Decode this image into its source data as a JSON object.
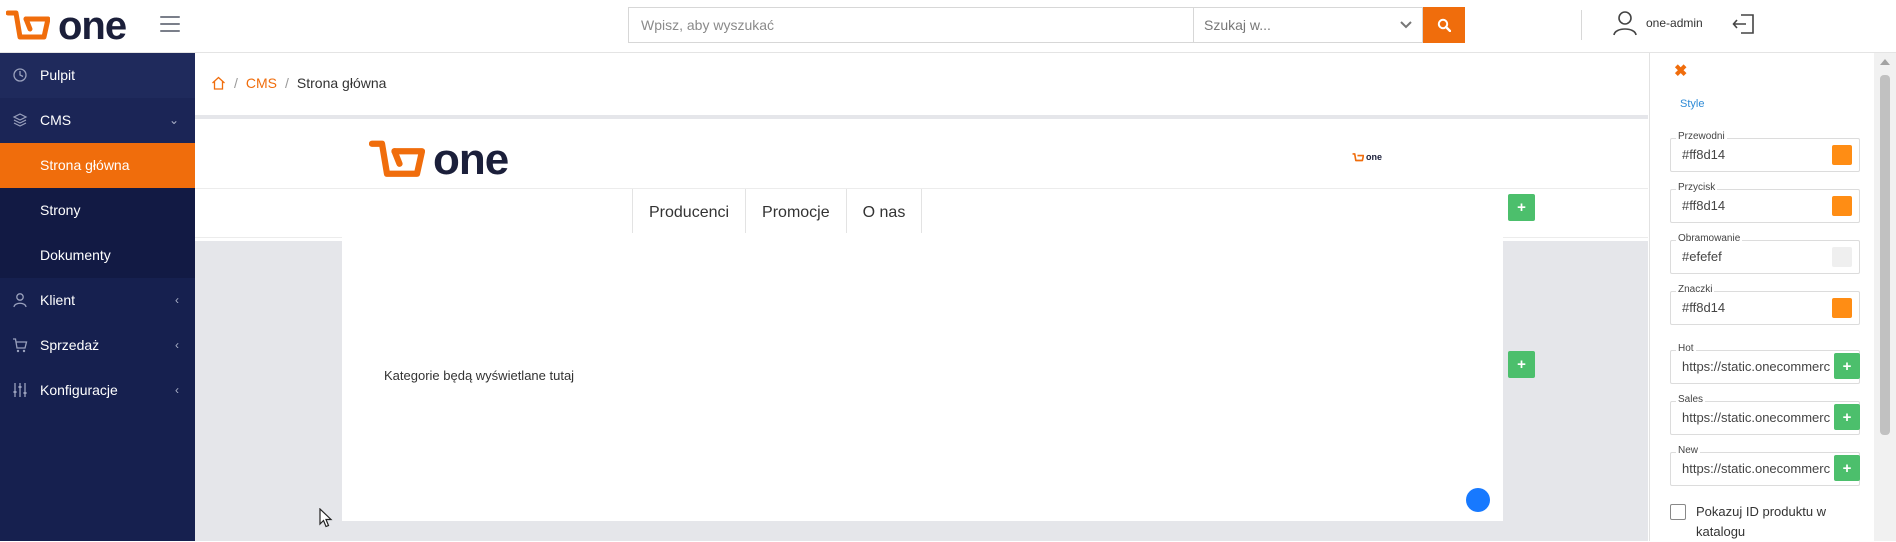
{
  "app": {
    "logo_text": "one",
    "search": {
      "placeholder": "Wpisz, aby wyszukać",
      "scope_label": "Szukaj w..."
    },
    "user_name": "one-admin"
  },
  "sidebar": {
    "items": [
      {
        "label": "Pulpit",
        "icon": "clock-icon"
      },
      {
        "label": "CMS",
        "icon": "layers-icon",
        "expanded": true,
        "children": [
          {
            "label": "Strona główna",
            "active": true
          },
          {
            "label": "Strony"
          },
          {
            "label": "Dokumenty"
          }
        ]
      },
      {
        "label": "Klient",
        "icon": "user-icon"
      },
      {
        "label": "Sprzedaż",
        "icon": "cart-icon"
      },
      {
        "label": "Konfiguracje",
        "icon": "sliders-icon"
      }
    ]
  },
  "breadcrumb": {
    "cms": "CMS",
    "current": "Strona główna"
  },
  "preview": {
    "logo_text": "one",
    "small_logo_text": "one",
    "menu": [
      "Producenci",
      "Promocje",
      "O nas"
    ],
    "categories_text": "Kategorie będą wyświetlane tutaj"
  },
  "style_panel": {
    "tab_label": "Style",
    "fields": [
      {
        "label": "Przewodni",
        "value": "#ff8d14",
        "color": "#ff8d14"
      },
      {
        "label": "Przycisk",
        "value": "#ff8d14",
        "color": "#ff8d14"
      },
      {
        "label": "Obramowanie",
        "value": "#efefef",
        "color": "#efefef"
      },
      {
        "label": "Znaczki",
        "value": "#ff8d14",
        "color": "#ff8d14"
      }
    ],
    "badges": [
      {
        "label": "Hot",
        "value": "https://static.onecommerce"
      },
      {
        "label": "Sales",
        "value": "https://static.onecommerce"
      },
      {
        "label": "New",
        "value": "https://static.onecommerce"
      }
    ],
    "checkbox_label": "Pokazuj ID produktu w katalogu"
  },
  "colors": {
    "accent": "#f06d0c",
    "sidebar": "#16204f",
    "add": "#4cbf6c"
  }
}
